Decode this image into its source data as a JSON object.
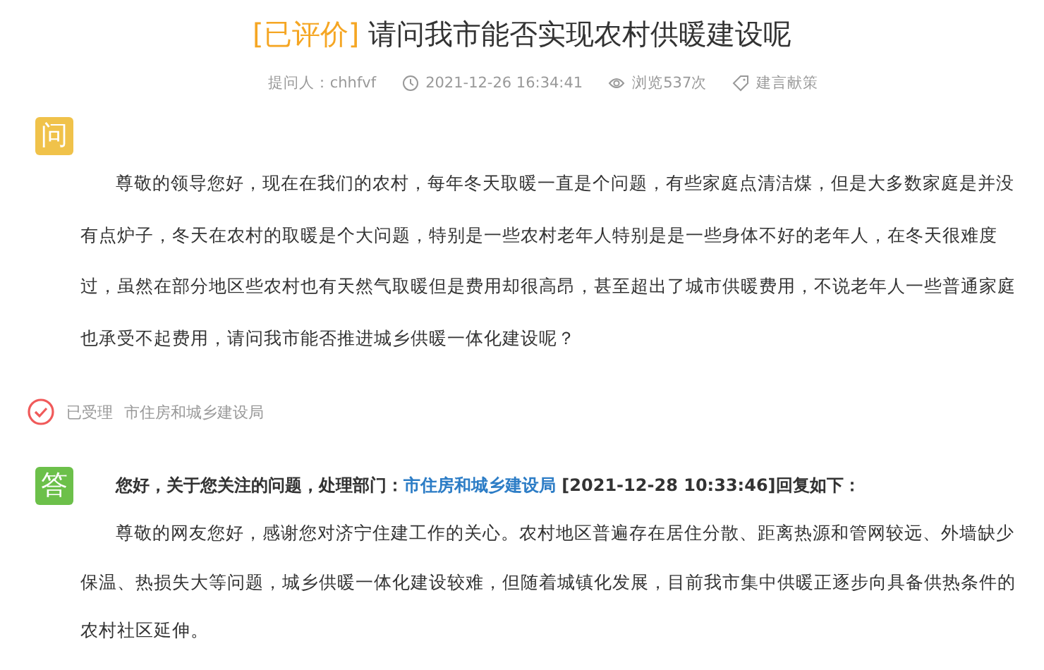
{
  "title": {
    "status_tag": "[已评价]",
    "text": "请问我市能否实现农村供暖建设呢"
  },
  "meta": [
    {
      "kind": "asker",
      "text": "提问人：chhfvf"
    },
    {
      "kind": "time",
      "text": "2021-12-26 16:34:41"
    },
    {
      "kind": "views",
      "text": "浏览537次"
    },
    {
      "kind": "category",
      "text": "建言献策"
    }
  ],
  "question": {
    "badge": "问",
    "body": "尊敬的领导您好，现在在我们的农村，每年冬天取暖一直是个问题，有些家庭点清洁煤，但是大多数家庭是并没有点炉子，冬天在农村的取暖是个大问题，特别是一些农村老年人特别是是一些身体不好的老年人，在冬天很难度过，虽然在部分地区些农村也有天然气取暖但是费用却很高昂，甚至超出了城市供暖费用，不说老年人一些普通家庭也承受不起费用，请问我市能否推进城乡供暖一体化建设呢？"
  },
  "status": {
    "label": "已受理",
    "department": "市住房和城乡建设局"
  },
  "answer": {
    "badge": "答",
    "heading_prefix": "您好，关于您关注的问题，处理部门：",
    "department_link": "市住房和城乡建设局",
    "heading_suffix": " [2021-12-28 10:33:46]回复如下：",
    "body": "尊敬的网友您好，感谢您对济宁住建工作的关心。农村地区普遍存在居住分散、距离热源和管网较远、外墙缺少保温、热损失大等问题，城乡供暖一体化建设较难，但随着城镇化发展，目前我市集中供暖正逐步向具备供热条件的农村社区延伸。"
  }
}
